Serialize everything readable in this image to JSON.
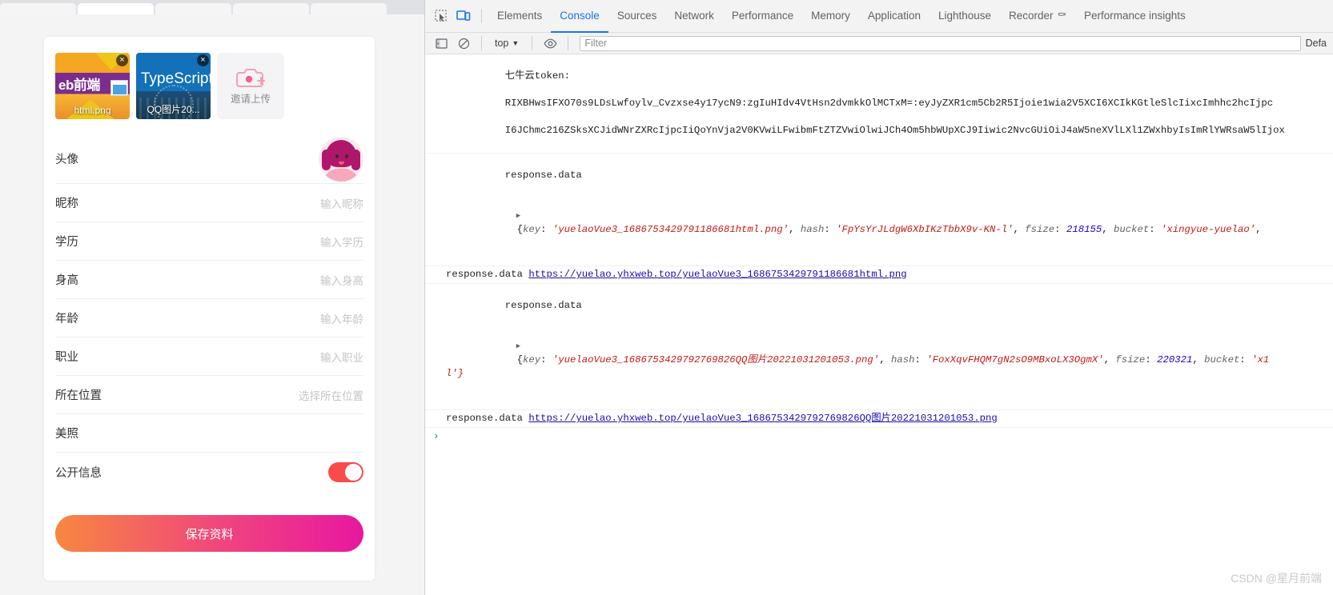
{
  "page": {
    "uploads": [
      {
        "caption": "html.png",
        "title_text": "eb前端",
        "close": "×"
      },
      {
        "caption": "QQ图片20...",
        "title_text": "TypeScript",
        "close": "×"
      }
    ],
    "add_upload_label": "邀请上传",
    "rows": [
      {
        "label": "头像",
        "value": ""
      },
      {
        "label": "昵称",
        "value": "输入昵称"
      },
      {
        "label": "学历",
        "value": "输入学历"
      },
      {
        "label": "身高",
        "value": "输入身高"
      },
      {
        "label": "年龄",
        "value": "输入年龄"
      },
      {
        "label": "职业",
        "value": "输入职业"
      },
      {
        "label": "所在位置",
        "value": "选择所在位置"
      },
      {
        "label": "美照",
        "value": ""
      },
      {
        "label": "公开信息",
        "value": ""
      }
    ],
    "save_label": "保存资料",
    "accent_gradient_start": "#f7873f",
    "accent_gradient_end": "#e8179f",
    "toggle_on_color": "#fa4b4b"
  },
  "devtools": {
    "tabs": [
      {
        "label": "Elements",
        "active": false
      },
      {
        "label": "Console",
        "active": true
      },
      {
        "label": "Sources",
        "active": false
      },
      {
        "label": "Network",
        "active": false
      },
      {
        "label": "Performance",
        "active": false
      },
      {
        "label": "Memory",
        "active": false
      },
      {
        "label": "Application",
        "active": false
      },
      {
        "label": "Lighthouse",
        "active": false
      },
      {
        "label": "Recorder",
        "active": false,
        "badge": "⚰"
      },
      {
        "label": "Performance insights",
        "active": false
      }
    ],
    "toolbar": {
      "inspect_icon": "inspect-element-icon",
      "device_icon": "device-toolbar-icon",
      "sidebar_icon": "console-sidebar-icon",
      "clear_icon": "clear-console-icon",
      "eye_icon": "live-expression-icon"
    },
    "filterbar": {
      "context": "top",
      "context_caret": "▼",
      "filter_placeholder": "Filter",
      "levels": "Defa"
    },
    "console": {
      "token_label": "七牛云token:",
      "token_line1": "RIXBHwsIFXO70s9LDsLwfoylv_Cvzxse4y17ycN9:zgIuHIdv4VtHsn2dvmkkOlMCTxM=:eyJyZXR1cm5Cb2R5Ijoie1wia2V5XCI6XCIkKGtleSlcIixcImhhc2hcIjpc",
      "token_line2": "I6JChmc216ZSksXCJidWNrZXRcIjpcIiQoYnVja2V0KVwiLFwibmFtZTZVwiOlwiJCh4Om5hbWUpXCJ9Iiwic2NvcGUiOiJ4aW5neXVlLXl1ZWxhbyIsImRlYWRsaW5lIjox",
      "entries": [
        {
          "label": "response.data",
          "expander": "▶",
          "obj_prefix": "{",
          "fields": [
            {
              "key": "key",
              "value": "'yuelaoVue3_1686753429791186681html.png'",
              "type": "str"
            },
            {
              "key": "hash",
              "value": "'FpYsYrJLdgW6XbIKzTbbX9v-KN-l'",
              "type": "str"
            },
            {
              "key": "fsize",
              "value": "218155",
              "type": "num"
            },
            {
              "key": "bucket",
              "value": "'xingyue-yuelao'",
              "type": "str"
            }
          ]
        },
        {
          "label": "response.data",
          "url": "https://yuelao.yhxweb.top/yuelaoVue3_1686753429791186681html.png"
        },
        {
          "label": "response.data",
          "expander": "▶",
          "obj_prefix": "{",
          "fields": [
            {
              "key": "key",
              "value": "'yuelaoVue3_1686753429792769826QQ图片20221031201053.png'",
              "type": "str"
            },
            {
              "key": "hash",
              "value": "'FoxXqvFHQM7gN2sO9MBxoLX3OgmX'",
              "type": "str"
            },
            {
              "key": "fsize",
              "value": "220321",
              "type": "num"
            },
            {
              "key": "bucket",
              "value": "'x1",
              "type": "str"
            }
          ],
          "wrap_tail": "l'}"
        },
        {
          "label": "response.data",
          "url": "https://yuelao.yhxweb.top/yuelaoVue3_1686753429792769826QQ图片20221031201053.png"
        }
      ],
      "prompt_caret": "›"
    }
  },
  "watermark": "CSDN @星月前端"
}
